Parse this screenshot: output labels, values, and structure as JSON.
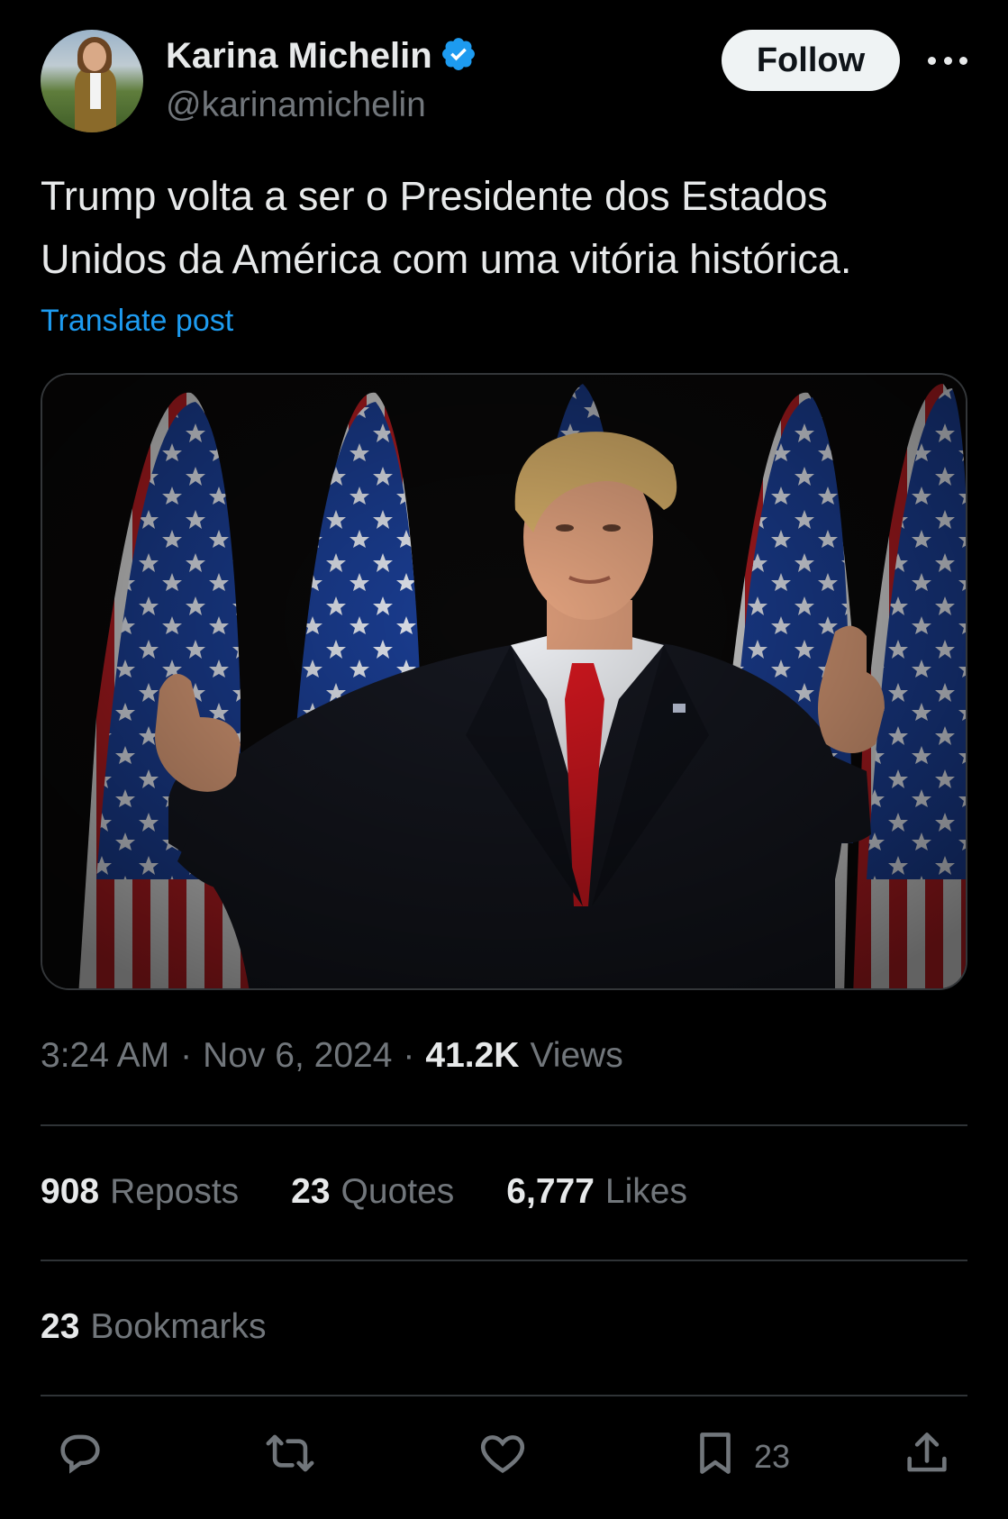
{
  "author": {
    "name": "Karina Michelin",
    "handle": "@karinamichelin",
    "verified": true,
    "follow_label": "Follow"
  },
  "post": {
    "text": "Trump volta a ser o Presidente dos Estados Unidos da América com uma vitória histórica.",
    "translate_label": "Translate post",
    "time": "3:24 AM",
    "date": "Nov 6, 2024",
    "views_count": "41.2K",
    "views_label": "Views"
  },
  "stats": {
    "reposts": {
      "count": "908",
      "label": "Reposts"
    },
    "quotes": {
      "count": "23",
      "label": "Quotes"
    },
    "likes": {
      "count": "6,777",
      "label": "Likes"
    },
    "bookmarks": {
      "count": "23",
      "label": "Bookmarks"
    }
  },
  "actions": {
    "bookmark_count": "23"
  },
  "colors": {
    "background": "#000000",
    "text": "#e7e9ea",
    "muted": "#71767b",
    "link": "#1d9bf0",
    "verified": "#1d9bf0",
    "divider": "#2f3336"
  },
  "icons": [
    "verified-badge-icon",
    "more-icon",
    "reply-icon",
    "repost-icon",
    "like-icon",
    "bookmark-icon",
    "share-icon"
  ]
}
